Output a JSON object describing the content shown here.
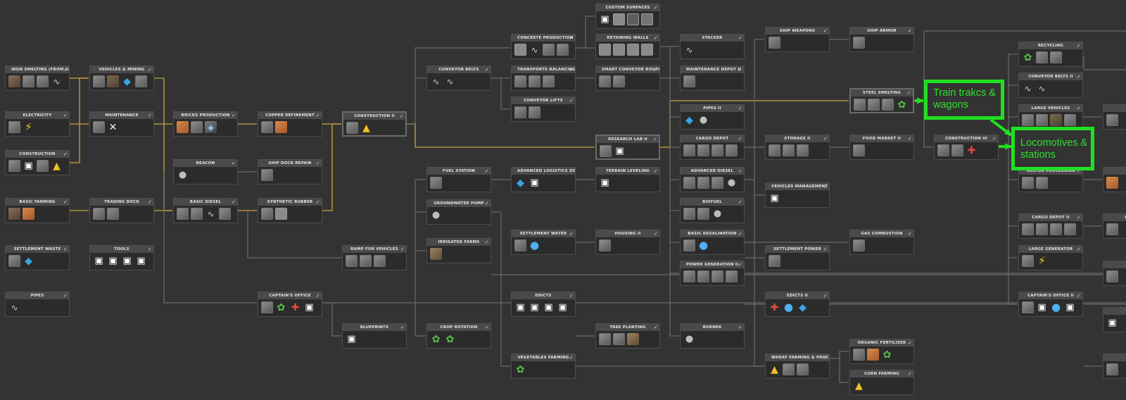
{
  "nodes": [
    {
      "title": "IRON SMELTING (FROM SCRAP)",
      "icons": [
        "scrap",
        "machine",
        "machine",
        "pipe"
      ]
    },
    {
      "title": "VEHICLES & MINING",
      "icons": [
        "machine",
        "truck",
        "blue",
        "machine"
      ]
    },
    {
      "title": "ELECTRICITY",
      "icons": [
        "machine",
        "bolt"
      ]
    },
    {
      "title": "MAINTENANCE",
      "icons": [
        "machine",
        "tools"
      ]
    },
    {
      "title": "CONSTRUCTION",
      "icons": [
        "machine",
        "white",
        "machine",
        "yellow"
      ]
    },
    {
      "title": "BRICKS PRODUCTION",
      "icons": [
        "brick",
        "machine",
        "mixed"
      ]
    },
    {
      "title": "COPPER REFINEMENT",
      "icons": [
        "machine",
        "brick"
      ]
    },
    {
      "title": "CONSTRUCTION II",
      "icons": [
        "machine",
        "yellow"
      ]
    },
    {
      "title": "BASIC FARMING",
      "icons": [
        "scrap",
        "brick"
      ]
    },
    {
      "title": "TRADING DOCK",
      "icons": [
        "machine",
        "machine"
      ]
    },
    {
      "title": "BEACON",
      "icons": [
        "gear"
      ]
    },
    {
      "title": "SHIP DOCK REPAIR",
      "icons": [
        "machine"
      ]
    },
    {
      "title": "BASIC DIESEL",
      "icons": [
        "machine",
        "machine",
        "pipe",
        "machine"
      ]
    },
    {
      "title": "SYNTHETIC RUBBER",
      "icons": [
        "machine",
        "stone"
      ]
    },
    {
      "title": "SETTLEMENT WASTE",
      "icons": [
        "machine",
        "blue"
      ]
    },
    {
      "title": "TOOLS",
      "icons": [
        "white",
        "white",
        "white",
        "white"
      ]
    },
    {
      "title": "PIPES",
      "icons": [
        "pipe"
      ]
    },
    {
      "title": "CAPTAIN'S OFFICE",
      "icons": [
        "machine",
        "green",
        "red",
        "white"
      ]
    },
    {
      "title": "BLUEPRINTS",
      "icons": [
        "white"
      ]
    },
    {
      "title": "RAMP FOR VEHICLES",
      "icons": [
        "machine",
        "machine",
        "machine"
      ]
    },
    {
      "title": "CONVEYOR BELTS",
      "icons": [
        "pipe",
        "pipe"
      ]
    },
    {
      "title": "FUEL STATION",
      "icons": [
        "machine"
      ]
    },
    {
      "title": "GROUNDWATER PUMP",
      "icons": [
        "gear"
      ]
    },
    {
      "title": "IRRIGATED FARMS",
      "icons": [
        "crate"
      ]
    },
    {
      "title": "CROP ROTATION",
      "icons": [
        "green",
        "green"
      ]
    },
    {
      "title": "CONCRETE PRODUCTION",
      "icons": [
        "stone",
        "pipe",
        "machine",
        "machine"
      ]
    },
    {
      "title": "TRANSPORTS BALANCING",
      "icons": [
        "machine",
        "machine",
        "machine"
      ]
    },
    {
      "title": "CONVEYOR LIFTS",
      "icons": [
        "machine",
        "machine"
      ]
    },
    {
      "title": "ADVANCED LOGISTICS CONTROL",
      "icons": [
        "blue",
        "white"
      ]
    },
    {
      "title": "SETTLEMENT WATER",
      "icons": [
        "machine",
        "water"
      ]
    },
    {
      "title": "EDICTS",
      "icons": [
        "white",
        "white",
        "white",
        "white"
      ]
    },
    {
      "title": "VEGETABLES FARMING",
      "icons": [
        "green"
      ]
    },
    {
      "title": "CUSTOM SURFACES",
      "icons": [
        "white",
        "stone",
        "stone dark",
        "stone mid"
      ]
    },
    {
      "title": "RETAINING WALLS",
      "icons": [
        "stone",
        "stone",
        "stone",
        "stone"
      ]
    },
    {
      "title": "SMART CONVEYOR ROUTING",
      "icons": [
        "machine",
        "machine"
      ]
    },
    {
      "title": "RESEARCH LAB II",
      "icons": [
        "machine",
        "white"
      ]
    },
    {
      "title": "TERRAIN LEVELING",
      "icons": [
        "white"
      ]
    },
    {
      "title": "HOUSING II",
      "icons": [
        "machine"
      ]
    },
    {
      "title": "TREE PLANTING",
      "icons": [
        "machine",
        "machine",
        "crate"
      ]
    },
    {
      "title": "STACKER",
      "icons": [
        "pipe"
      ]
    },
    {
      "title": "MAINTENANCE DEPOT II",
      "icons": [
        "machine"
      ]
    },
    {
      "title": "PIPES II",
      "icons": [
        "blue",
        "gear"
      ]
    },
    {
      "title": "CARGO DEPOT",
      "icons": [
        "machine",
        "machine",
        "machine",
        "machine"
      ]
    },
    {
      "title": "ADVANCED DIESEL",
      "icons": [
        "machine",
        "machine",
        "machine",
        "gear"
      ]
    },
    {
      "title": "BIOFUEL",
      "icons": [
        "machine",
        "machine",
        "gear"
      ]
    },
    {
      "title": "BASIC DESALINATION",
      "icons": [
        "machine",
        "water"
      ]
    },
    {
      "title": "POWER GENERATION II",
      "icons": [
        "machine",
        "machine",
        "machine",
        "machine"
      ]
    },
    {
      "title": "BURNER",
      "icons": [
        "gear"
      ]
    },
    {
      "title": "SHIP WEAPONS",
      "icons": [
        "machine"
      ]
    },
    {
      "title": "STORAGE II",
      "icons": [
        "machine",
        "machine",
        "machine"
      ]
    },
    {
      "title": "VEHICLES MANAGEMENT II",
      "icons": [
        "white"
      ]
    },
    {
      "title": "SETTLEMENT POWER",
      "icons": [
        "machine"
      ]
    },
    {
      "title": "EDICTS II",
      "icons": [
        "red",
        "water",
        "blue"
      ]
    },
    {
      "title": "WHEAT FARMING & PROCESSING",
      "icons": [
        "yellow",
        "machine",
        "machine"
      ]
    },
    {
      "title": "SHIP ARMOR",
      "icons": [
        "machine"
      ]
    },
    {
      "title": "STEEL SMELTING",
      "icons": [
        "machine",
        "machine",
        "machine",
        "green"
      ]
    },
    {
      "title": "FOOD MARKET II",
      "icons": [
        "machine"
      ]
    },
    {
      "title": "GAS COMBUSTION",
      "icons": [
        "machine"
      ]
    },
    {
      "title": "ORGANIC FERTILIZER",
      "icons": [
        "machine",
        "brick",
        "green"
      ]
    },
    {
      "title": "CORN FARMING",
      "icons": [
        "yellow"
      ]
    },
    {
      "title": "CONSTRUCTION III",
      "icons": [
        "machine",
        "machine",
        "red"
      ]
    },
    {
      "title": "RECYCLING",
      "icons": [
        "green",
        "machine",
        "machine"
      ]
    },
    {
      "title": "CONVEYOR BELTS II",
      "icons": [
        "pipe",
        "pipe"
      ]
    },
    {
      "title": "LARGE VEHICLES",
      "icons": [
        "machine",
        "machine",
        "truck",
        "machine"
      ]
    },
    {
      "title": "SULFUR PROCESSING",
      "icons": [
        "machine",
        "machine"
      ]
    },
    {
      "title": "CARGO DEPOT II",
      "icons": [
        "machine",
        "machine",
        "machine",
        "machine"
      ]
    },
    {
      "title": "LARGE GENERATOR",
      "icons": [
        "machine",
        "bolt"
      ]
    },
    {
      "title": "CAPTAIN'S OFFICE II",
      "icons": [
        "machine",
        "white",
        "water",
        "white"
      ]
    },
    {
      "title": "FU",
      "icons": [
        "machine"
      ]
    },
    {
      "title": "COPPE",
      "icons": [
        "brick"
      ]
    },
    {
      "title": "CHEMICA",
      "icons": [
        "machine"
      ]
    },
    {
      "title": "WAT",
      "icons": [
        "machine"
      ]
    },
    {
      "title": "VEHICLE",
      "icons": [
        "white"
      ]
    },
    {
      "title": "SOYB",
      "icons": [
        "machine"
      ]
    }
  ],
  "checkmark": "✓",
  "callouts": {
    "train": "Train trakcs & wagons",
    "locos": "Locomotives & stations"
  },
  "colors": {
    "wire_research": "#b0913a",
    "wire_locked": "#6a6a6a",
    "callout": "#21e021"
  }
}
